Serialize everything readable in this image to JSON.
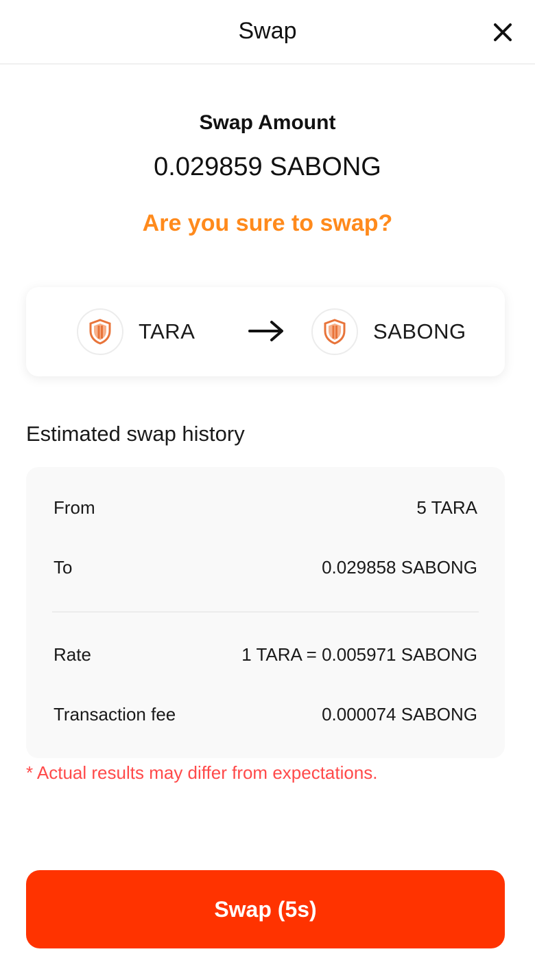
{
  "header": {
    "title": "Swap",
    "close_icon": "close-icon"
  },
  "summary": {
    "amount_label": "Swap Amount",
    "amount_value": "0.029859 SABONG",
    "confirm_question": "Are you sure to swap?"
  },
  "pair": {
    "from_token": "TARA",
    "to_token": "SABONG",
    "from_icon": "shield-token-icon",
    "to_icon": "shield-token-icon",
    "arrow_icon": "arrow-right-icon"
  },
  "history": {
    "title": "Estimated swap history",
    "rows": [
      {
        "label": "From",
        "value": "5 TARA"
      },
      {
        "label": "To",
        "value": "0.029858 SABONG"
      },
      {
        "label": "Rate",
        "value": "1 TARA = 0.005971 SABONG"
      },
      {
        "label": "Transaction fee",
        "value": "0.000074 SABONG"
      }
    ]
  },
  "disclaimer": "* Actual results may differ from expectations.",
  "action": {
    "swap_label": "Swap (5s)"
  },
  "colors": {
    "accent_orange": "#ff8a1c",
    "button_red": "#ff3300",
    "warning_red": "#ff4a4a",
    "token_icon_orange": "#e8743a"
  }
}
